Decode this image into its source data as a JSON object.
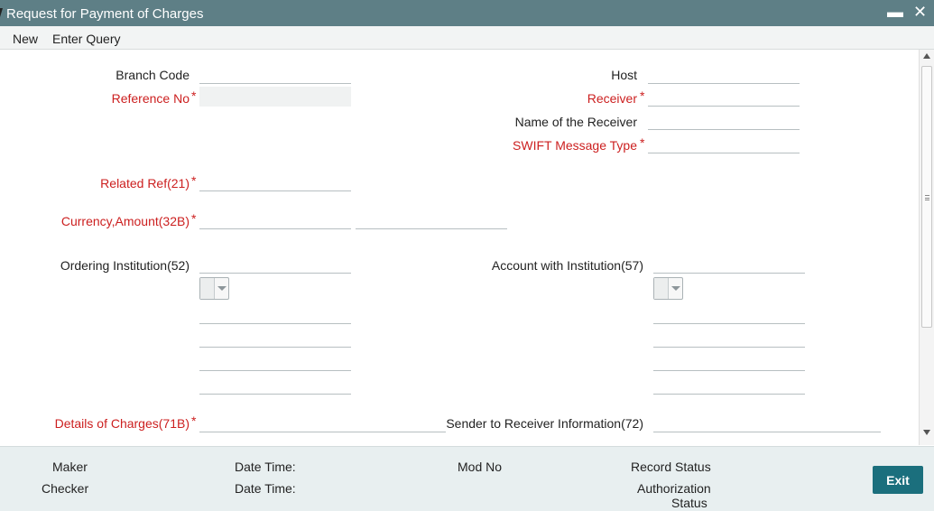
{
  "window": {
    "title": "Request for Payment of Charges",
    "minimize_icon": "minimize-icon",
    "close_icon": "close-icon",
    "minimize_glyph": "▬",
    "close_glyph": "✕"
  },
  "menu": {
    "new_label": "New",
    "enter_query_label": "Enter Query"
  },
  "form": {
    "branch_code": {
      "label": "Branch Code",
      "value": ""
    },
    "reference_no": {
      "label": "Reference No",
      "required": "*",
      "value": ""
    },
    "host": {
      "label": "Host",
      "value": ""
    },
    "receiver": {
      "label": "Receiver",
      "required": "*",
      "value": ""
    },
    "name_of_receiver": {
      "label": "Name of the Receiver",
      "value": ""
    },
    "swift_message_type": {
      "label": "SWIFT Message Type",
      "required": "*",
      "value": ""
    },
    "related_ref": {
      "label": "Related Ref(21)",
      "required": "*",
      "value": ""
    },
    "currency_amount": {
      "label": "Currency,Amount(32B)",
      "required": "*",
      "currency": "",
      "amount": ""
    },
    "ordering_institution": {
      "label": "Ordering Institution(52)",
      "line1": "",
      "option": "",
      "line2": "",
      "line3": "",
      "line4": "",
      "line5": ""
    },
    "account_with_institution": {
      "label": "Account with Institution(57)",
      "line1": "",
      "option": "",
      "line2": "",
      "line3": "",
      "line4": "",
      "line5": ""
    },
    "details_of_charges": {
      "label": "Details of Charges(71B)",
      "required": "*",
      "value": ""
    },
    "sender_to_receiver_info": {
      "label": "Sender to Receiver Information(72)",
      "value": ""
    }
  },
  "footer": {
    "maker_label": "Maker",
    "checker_label": "Checker",
    "maker_date_time_label": "Date Time:",
    "checker_date_time_label": "Date Time:",
    "mod_no_label": "Mod No",
    "record_status_label": "Record Status",
    "authorization_status_label_1": "Authorization",
    "authorization_status_label_2": "Status",
    "exit_label": "Exit"
  },
  "colors": {
    "titlebar": "#5e7f86",
    "required_label": "#cc1f1f",
    "exit_button": "#1b6f7d",
    "footer_bg": "#e8eff0"
  }
}
